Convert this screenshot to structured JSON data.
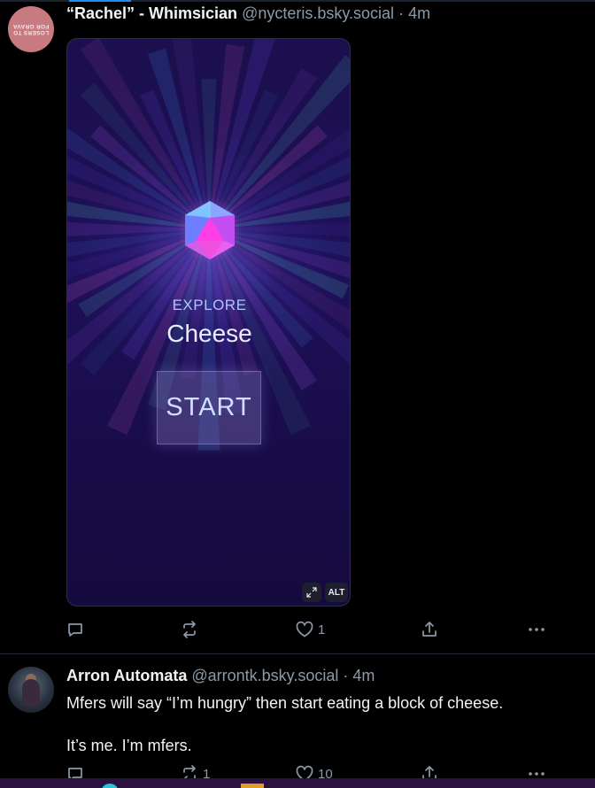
{
  "post1": {
    "avatar_text": "LOSERS TO FOR GRAVA",
    "name": "“Rachel” - Whimsician",
    "handle": "@nycteris.bsky.social",
    "separator": "·",
    "time": "4m",
    "media": {
      "explore_label": "EXPLORE",
      "subject": "Cheese",
      "start_label": "START",
      "alt_label": "ALT"
    },
    "actions": {
      "reply_count": "",
      "repost_count": "",
      "like_count": "1"
    }
  },
  "post2": {
    "name": "Arron Automata",
    "handle": "@arrontk.bsky.social",
    "separator": "·",
    "time": "4m",
    "text_line1": "Mfers will say “I’m hungry” then start eating a block of cheese.",
    "text_line2": "It’s me. I’m mfers.",
    "actions": {
      "reply_count": "",
      "repost_count": "1",
      "like_count": "10"
    }
  },
  "colors": {
    "background": "#000000",
    "muted_text": "#8c9aa8",
    "accent": "#1d8cf5",
    "media_bg": "#1b0f4d"
  }
}
